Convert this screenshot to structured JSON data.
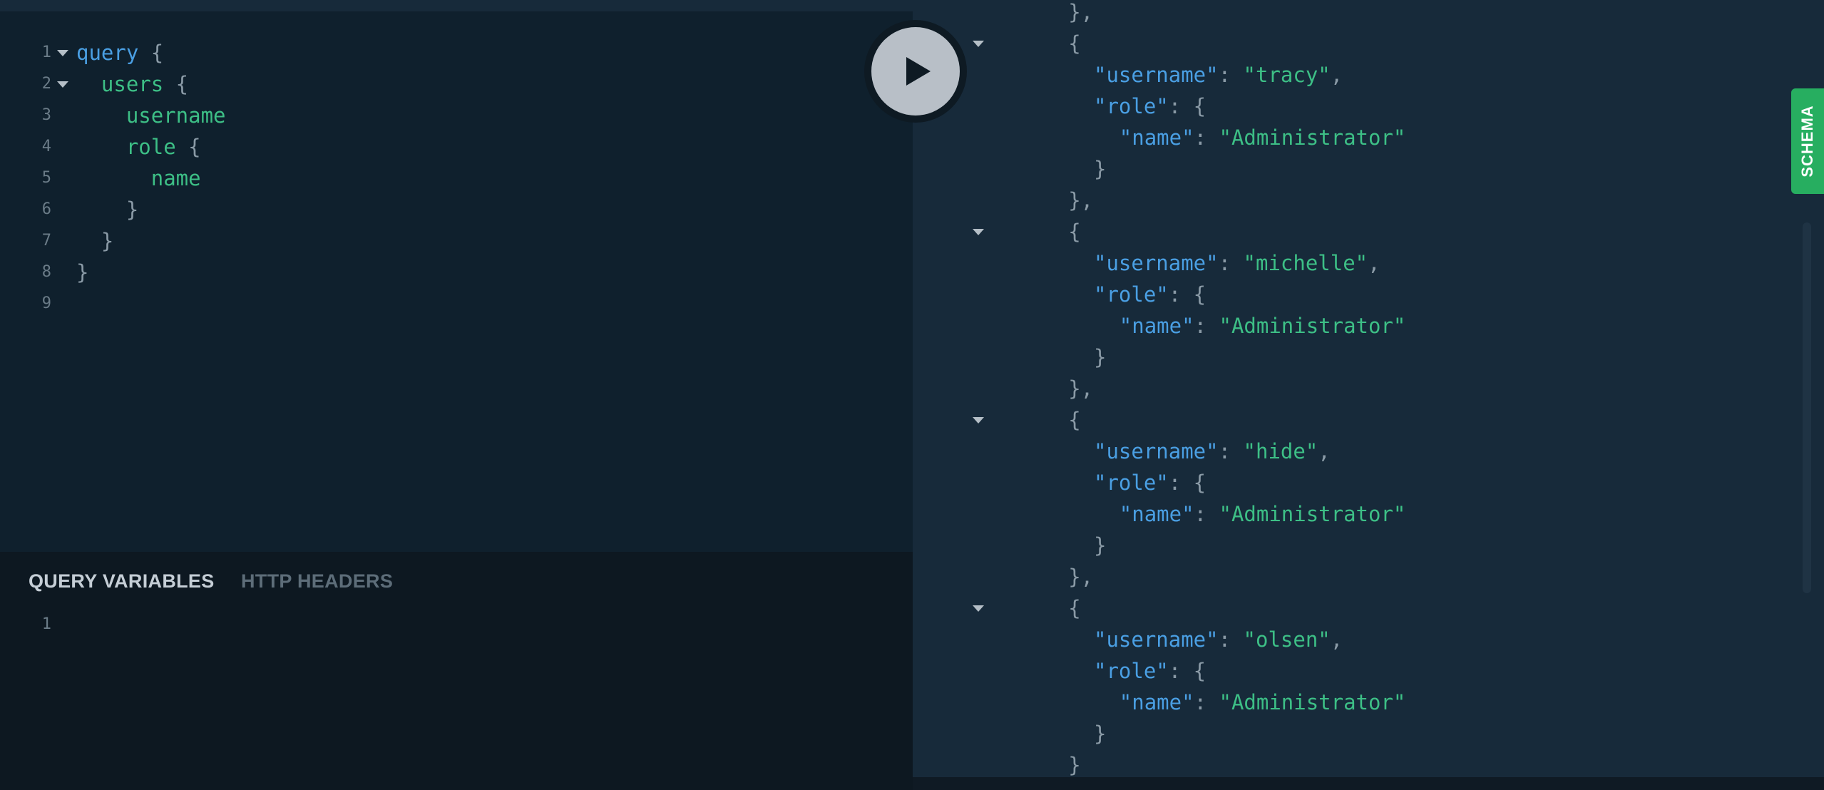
{
  "editor": {
    "line_numbers": [
      "1",
      "2",
      "3",
      "4",
      "5",
      "6",
      "7",
      "8",
      "9"
    ],
    "lines": [
      [
        {
          "t": "query",
          "c": "kw"
        },
        {
          "t": " {",
          "c": "pun"
        }
      ],
      [
        {
          "t": "  users",
          "c": "fld"
        },
        {
          "t": " {",
          "c": "pun"
        }
      ],
      [
        {
          "t": "    username",
          "c": "fld"
        }
      ],
      [
        {
          "t": "    role",
          "c": "fld"
        },
        {
          "t": " {",
          "c": "pun"
        }
      ],
      [
        {
          "t": "      name",
          "c": "fld"
        }
      ],
      [
        {
          "t": "    }",
          "c": "pun"
        }
      ],
      [
        {
          "t": "  }",
          "c": "pun"
        }
      ],
      [
        {
          "t": "}",
          "c": "pun"
        }
      ],
      []
    ],
    "fold_lines": [
      1,
      2
    ]
  },
  "variables_panel": {
    "tab_query_variables": "QUERY VARIABLES",
    "tab_http_headers": "HTTP HEADERS",
    "line_number": "1"
  },
  "execute_button": {
    "icon": "play-icon"
  },
  "schema_tab": {
    "label": "SCHEMA"
  },
  "result": {
    "lines": [
      {
        "indent": 8,
        "parts": [
          {
            "t": "},",
            "c": "pun"
          }
        ]
      },
      {
        "indent": 8,
        "fold": true,
        "parts": [
          {
            "t": "{",
            "c": "pun"
          }
        ]
      },
      {
        "indent": 10,
        "parts": [
          {
            "t": "\"username\"",
            "c": "key"
          },
          {
            "t": ": ",
            "c": "pun"
          },
          {
            "t": "\"tracy\"",
            "c": "str"
          },
          {
            "t": ",",
            "c": "pun"
          }
        ]
      },
      {
        "indent": 10,
        "parts": [
          {
            "t": "\"role\"",
            "c": "key"
          },
          {
            "t": ": {",
            "c": "pun"
          }
        ]
      },
      {
        "indent": 12,
        "parts": [
          {
            "t": "\"name\"",
            "c": "key"
          },
          {
            "t": ": ",
            "c": "pun"
          },
          {
            "t": "\"Administrator\"",
            "c": "str"
          }
        ]
      },
      {
        "indent": 10,
        "parts": [
          {
            "t": "}",
            "c": "pun"
          }
        ]
      },
      {
        "indent": 8,
        "parts": [
          {
            "t": "},",
            "c": "pun"
          }
        ]
      },
      {
        "indent": 8,
        "fold": true,
        "parts": [
          {
            "t": "{",
            "c": "pun"
          }
        ]
      },
      {
        "indent": 10,
        "parts": [
          {
            "t": "\"username\"",
            "c": "key"
          },
          {
            "t": ": ",
            "c": "pun"
          },
          {
            "t": "\"michelle\"",
            "c": "str"
          },
          {
            "t": ",",
            "c": "pun"
          }
        ]
      },
      {
        "indent": 10,
        "parts": [
          {
            "t": "\"role\"",
            "c": "key"
          },
          {
            "t": ": {",
            "c": "pun"
          }
        ]
      },
      {
        "indent": 12,
        "parts": [
          {
            "t": "\"name\"",
            "c": "key"
          },
          {
            "t": ": ",
            "c": "pun"
          },
          {
            "t": "\"Administrator\"",
            "c": "str"
          }
        ]
      },
      {
        "indent": 10,
        "parts": [
          {
            "t": "}",
            "c": "pun"
          }
        ]
      },
      {
        "indent": 8,
        "parts": [
          {
            "t": "},",
            "c": "pun"
          }
        ]
      },
      {
        "indent": 8,
        "fold": true,
        "parts": [
          {
            "t": "{",
            "c": "pun"
          }
        ]
      },
      {
        "indent": 10,
        "parts": [
          {
            "t": "\"username\"",
            "c": "key"
          },
          {
            "t": ": ",
            "c": "pun"
          },
          {
            "t": "\"hide\"",
            "c": "str"
          },
          {
            "t": ",",
            "c": "pun"
          }
        ]
      },
      {
        "indent": 10,
        "parts": [
          {
            "t": "\"role\"",
            "c": "key"
          },
          {
            "t": ": {",
            "c": "pun"
          }
        ]
      },
      {
        "indent": 12,
        "parts": [
          {
            "t": "\"name\"",
            "c": "key"
          },
          {
            "t": ": ",
            "c": "pun"
          },
          {
            "t": "\"Administrator\"",
            "c": "str"
          }
        ]
      },
      {
        "indent": 10,
        "parts": [
          {
            "t": "}",
            "c": "pun"
          }
        ]
      },
      {
        "indent": 8,
        "parts": [
          {
            "t": "},",
            "c": "pun"
          }
        ]
      },
      {
        "indent": 8,
        "fold": true,
        "parts": [
          {
            "t": "{",
            "c": "pun"
          }
        ]
      },
      {
        "indent": 10,
        "parts": [
          {
            "t": "\"username\"",
            "c": "key"
          },
          {
            "t": ": ",
            "c": "pun"
          },
          {
            "t": "\"olsen\"",
            "c": "str"
          },
          {
            "t": ",",
            "c": "pun"
          }
        ]
      },
      {
        "indent": 10,
        "parts": [
          {
            "t": "\"role\"",
            "c": "key"
          },
          {
            "t": ": {",
            "c": "pun"
          }
        ]
      },
      {
        "indent": 12,
        "parts": [
          {
            "t": "\"name\"",
            "c": "key"
          },
          {
            "t": ": ",
            "c": "pun"
          },
          {
            "t": "\"Administrator\"",
            "c": "str"
          }
        ]
      },
      {
        "indent": 10,
        "parts": [
          {
            "t": "}",
            "c": "pun"
          }
        ]
      },
      {
        "indent": 8,
        "parts": [
          {
            "t": "}",
            "c": "pun"
          }
        ]
      }
    ]
  },
  "colors": {
    "keyword": "#4a9fe3",
    "field": "#3dbf86",
    "punctuation": "#8a9aa6",
    "schema_tab": "#27ae60",
    "editor_bg": "#0f202d",
    "result_bg": "#172a3a"
  }
}
